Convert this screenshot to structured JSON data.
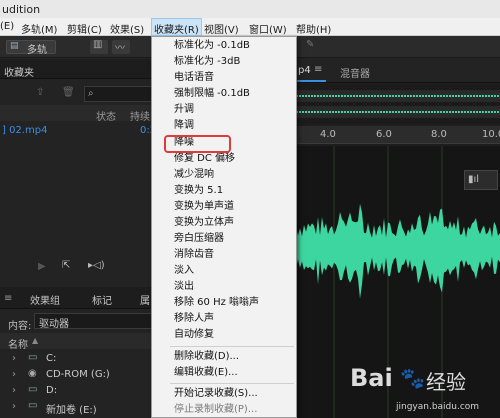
{
  "title_bar": {
    "title": "udition"
  },
  "menubar": {
    "items": [
      {
        "label": "(E)",
        "active": false
      },
      {
        "label": "多轨(M)",
        "active": false
      },
      {
        "label": "剪辑(C)",
        "active": false
      },
      {
        "label": "效果(S)",
        "active": false
      },
      {
        "label": "收藏夹(R)",
        "active": true
      },
      {
        "label": "视图(V)",
        "active": false
      },
      {
        "label": "窗口(W)",
        "active": false
      },
      {
        "label": "帮助(H)",
        "active": false
      }
    ]
  },
  "toolbar": {
    "multitrack_label": "多轨"
  },
  "left_panel": {
    "favorites_tab": "收藏夹",
    "columns": {
      "status": "状态",
      "duration": "持续"
    },
    "file_row": {
      "name": "] 02.mp4",
      "duration": "0:2"
    },
    "tabs": {
      "effects_group": "效果组",
      "markers": "标记",
      "properties": "属"
    },
    "location_label": "内容:",
    "location_value": "驱动器",
    "tree_header": "名称",
    "drives": [
      {
        "label": "C:",
        "icon": "drive-icon"
      },
      {
        "label": "CD-ROM (G:)",
        "icon": "cdrom-icon"
      },
      {
        "label": "D:",
        "icon": "drive-icon"
      },
      {
        "label": "新加卷 (E:)",
        "icon": "drive-icon"
      }
    ]
  },
  "editor": {
    "tab_file": "p4",
    "tab_mixer": "混音器",
    "ruler_marks": [
      "4.0",
      "6.0",
      "8.0",
      "10.0",
      "1"
    ]
  },
  "favorites_menu": {
    "items": [
      {
        "label": "标准化为 -0.1dB",
        "disabled": false
      },
      {
        "label": "标准化为 -3dB",
        "disabled": false
      },
      {
        "label": "电话语音",
        "disabled": false
      },
      {
        "label": "强制限幅 -0.1dB",
        "disabled": false
      },
      {
        "label": "升调",
        "disabled": false
      },
      {
        "label": "降调",
        "disabled": false
      },
      {
        "label": "降噪",
        "disabled": false,
        "highlighted": true
      },
      {
        "label": "修复 DC 偏移",
        "disabled": false
      },
      {
        "label": "减少混响",
        "disabled": false
      },
      {
        "label": "变换为 5.1",
        "disabled": false
      },
      {
        "label": "变换为单声道",
        "disabled": false
      },
      {
        "label": "变换为立体声",
        "disabled": false
      },
      {
        "label": "旁白压缩器",
        "disabled": false
      },
      {
        "label": "消除齿音",
        "disabled": false
      },
      {
        "label": "淡入",
        "disabled": false
      },
      {
        "label": "淡出",
        "disabled": false
      },
      {
        "label": "移除 60 Hz 嗡嗡声",
        "disabled": false
      },
      {
        "label": "移除人声",
        "disabled": false
      },
      {
        "label": "自动修复",
        "disabled": false
      },
      {
        "label": "删除收藏(D)...",
        "disabled": false
      },
      {
        "label": "编辑收藏(E)...",
        "disabled": false
      },
      {
        "label": "开始记录收藏(S)...",
        "disabled": false
      },
      {
        "label": "停止录制收藏(P)...",
        "disabled": true
      }
    ]
  },
  "watermark": {
    "brand": "Bai",
    "brand2": "经验",
    "url": "jingyan.baidu.com"
  },
  "colors": {
    "waveform": "#3dd6a0",
    "menu_bg": "#f2f2f2",
    "highlight": "#e03a3a",
    "link_blue": "#3b8fe0"
  }
}
